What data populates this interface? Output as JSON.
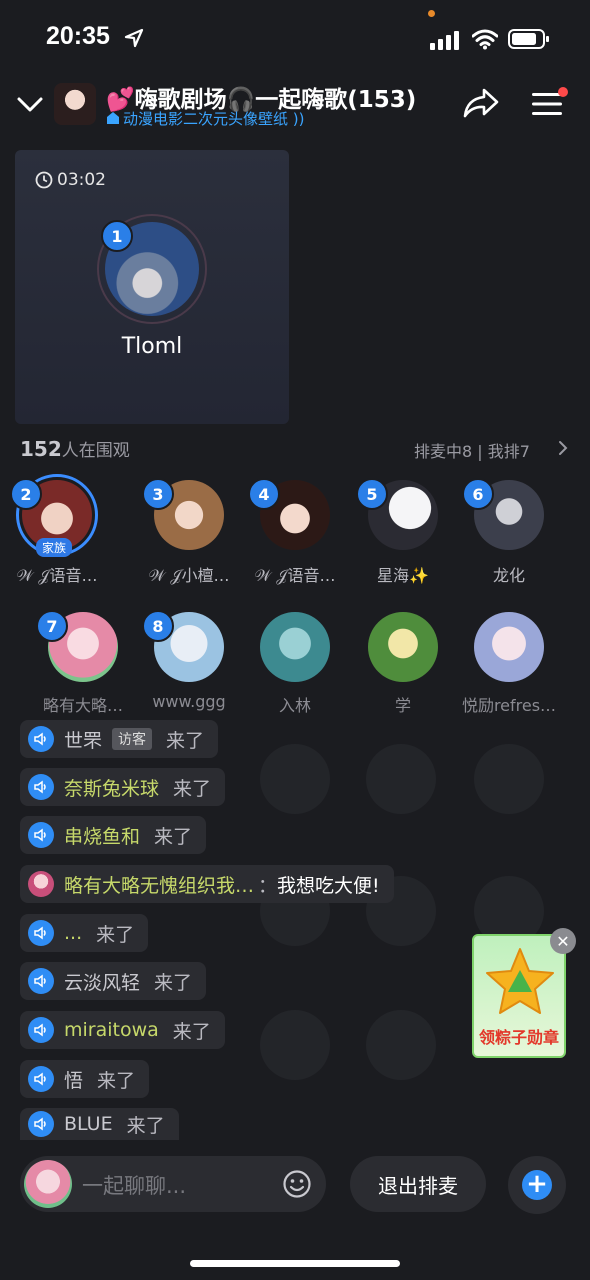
{
  "status_bar": {
    "time": "20:35"
  },
  "header": {
    "title": "💕嗨歌剧场🎧一起嗨歌(153)",
    "subtitle": "动漫电影二次元头像壁纸"
  },
  "host": {
    "timer": "03:02",
    "seat_number": "1",
    "name": "Tloml"
  },
  "audience": {
    "count": "152",
    "label": "人在围观",
    "queue": "排麦中8 | 我排7"
  },
  "seats": [
    {
      "number": "2",
      "name": "𝒲 𝒥语音…",
      "tag": "家族"
    },
    {
      "number": "3",
      "name": "𝒲 𝒥小檀…"
    },
    {
      "number": "4",
      "name": "𝒲 𝒥语音…"
    },
    {
      "number": "5",
      "name": "星海✨"
    },
    {
      "number": "6",
      "name": "龙化"
    },
    {
      "number": "7",
      "name": "略有大略…"
    },
    {
      "number": "8",
      "name": "www.ggg"
    },
    {
      "number": "",
      "name": "入林"
    },
    {
      "number": "",
      "name": "学"
    },
    {
      "number": "",
      "name": "悦励refres…"
    }
  ],
  "chat": [
    {
      "user": "世罘",
      "tag": "访客",
      "action": "来了"
    },
    {
      "user": "奈斯兔米球",
      "action": "来了"
    },
    {
      "user": "串烧鱼和",
      "action": "来了"
    },
    {
      "user": "略有大略无愧组织我…",
      "separator": "：",
      "text": "我想吃大便!"
    },
    {
      "user": "...",
      "action": "来了"
    },
    {
      "user": "云淡风轻",
      "action": "来了"
    },
    {
      "user": "miraitowa",
      "action": "来了"
    },
    {
      "user": "悟",
      "action": "来了"
    },
    {
      "user": "BLUE",
      "action": "来了"
    }
  ],
  "promo": {
    "label": "领粽子勋章"
  },
  "bottom": {
    "placeholder": "一起聊聊...",
    "exit_button": "退出排麦"
  },
  "colors": {
    "accent": "#2f8df5",
    "background": "#1b1c20",
    "username_highlight": "#c6d86a",
    "promo_text": "#e3372a"
  }
}
